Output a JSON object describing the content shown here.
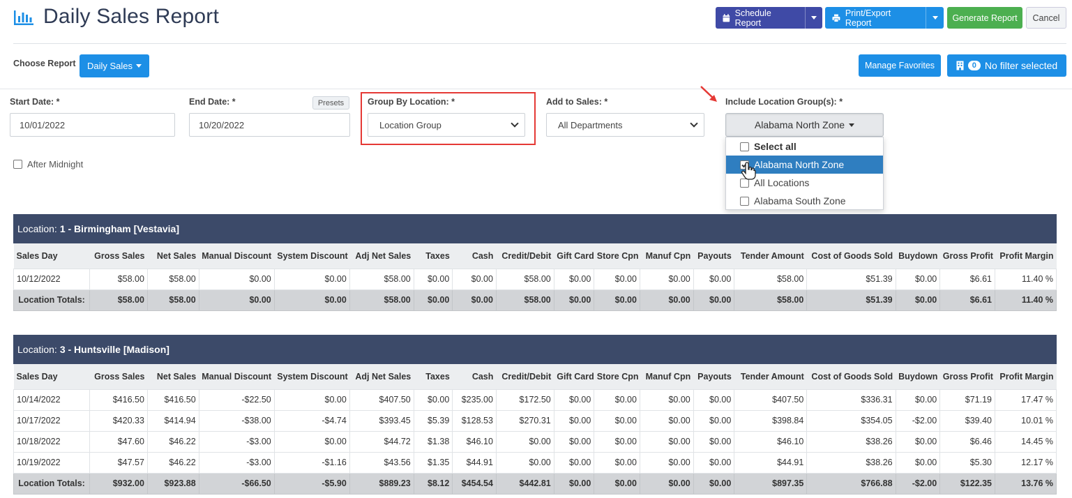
{
  "header": {
    "title": "Daily Sales Report",
    "schedule_label": "Schedule Report",
    "print_label": "Print/Export Report",
    "generate_label": "Generate Report",
    "cancel_label": "Cancel",
    "colors": {
      "schedule": "#3f4aa6",
      "primary": "#1d8fe6",
      "generate": "#4caf50",
      "title": "#2f3b55"
    }
  },
  "toolbar": {
    "choose_report_label": "Choose Report",
    "report_selected": "Daily Sales",
    "manage_favorites_label": "Manage Favorites",
    "filter_count": "0",
    "filter_label": "No filter selected"
  },
  "filters": {
    "start_date_label": "Start Date: *",
    "start_date_value": "10/01/2022",
    "end_date_label": "End Date: *",
    "end_date_value": "10/20/2022",
    "presets_label": "Presets",
    "group_by_label": "Group By Location: *",
    "group_by_value": "Location Group",
    "add_to_sales_label": "Add to Sales: *",
    "add_to_sales_value": "All Departments",
    "include_groups_label": "Include Location Group(s): *",
    "include_groups_value": "Alabama North Zone",
    "after_midnight_label": "After Midnight"
  },
  "location_dropdown": {
    "items": [
      {
        "label": "Select all",
        "checked": false
      },
      {
        "label": "Alabama North Zone",
        "checked": true
      },
      {
        "label": "All Locations",
        "checked": false
      },
      {
        "label": "Alabama South Zone",
        "checked": false
      }
    ]
  },
  "columns": [
    "Sales Day",
    "Gross Sales",
    "Net Sales",
    "Manual Discount",
    "System Discount",
    "Adj Net Sales",
    "Taxes",
    "Cash",
    "Credit/Debit",
    "Gift Card",
    "Store Cpn",
    "Manuf Cpn",
    "Payouts",
    "Tender Amount",
    "Cost of Goods Sold",
    "Buydown",
    "Gross Profit",
    "Profit Margin"
  ],
  "locations": [
    {
      "prefix": "Location:",
      "name": "1 - Birmingham [Vestavia]",
      "rows": [
        [
          "10/12/2022",
          "$58.00",
          "$58.00",
          "$0.00",
          "$0.00",
          "$58.00",
          "$0.00",
          "$0.00",
          "$58.00",
          "$0.00",
          "$0.00",
          "$0.00",
          "$0.00",
          "$58.00",
          "$51.39",
          "$0.00",
          "$6.61",
          "11.40 %"
        ]
      ],
      "totals": [
        "Location Totals:",
        "$58.00",
        "$58.00",
        "$0.00",
        "$0.00",
        "$58.00",
        "$0.00",
        "$0.00",
        "$58.00",
        "$0.00",
        "$0.00",
        "$0.00",
        "$0.00",
        "$58.00",
        "$51.39",
        "$0.00",
        "$6.61",
        "11.40 %"
      ]
    },
    {
      "prefix": "Location:",
      "name": "3 - Huntsville [Madison]",
      "rows": [
        [
          "10/14/2022",
          "$416.50",
          "$416.50",
          "-$22.50",
          "$0.00",
          "$407.50",
          "$0.00",
          "$235.00",
          "$172.50",
          "$0.00",
          "$0.00",
          "$0.00",
          "$0.00",
          "$407.50",
          "$336.31",
          "$0.00",
          "$71.19",
          "17.47 %"
        ],
        [
          "10/17/2022",
          "$420.33",
          "$414.94",
          "-$38.00",
          "-$4.74",
          "$393.45",
          "$5.39",
          "$128.53",
          "$270.31",
          "$0.00",
          "$0.00",
          "$0.00",
          "$0.00",
          "$398.84",
          "$354.05",
          "-$2.00",
          "$39.40",
          "10.01 %"
        ],
        [
          "10/18/2022",
          "$47.60",
          "$46.22",
          "-$3.00",
          "$0.00",
          "$44.72",
          "$1.38",
          "$46.10",
          "$0.00",
          "$0.00",
          "$0.00",
          "$0.00",
          "$0.00",
          "$46.10",
          "$38.26",
          "$0.00",
          "$6.46",
          "14.45 %"
        ],
        [
          "10/19/2022",
          "$47.57",
          "$46.22",
          "-$3.00",
          "-$1.16",
          "$43.56",
          "$1.35",
          "$44.91",
          "$0.00",
          "$0.00",
          "$0.00",
          "$0.00",
          "$0.00",
          "$44.91",
          "$38.26",
          "$0.00",
          "$5.30",
          "12.17 %"
        ]
      ],
      "totals": [
        "Location Totals:",
        "$932.00",
        "$923.88",
        "-$66.50",
        "-$5.90",
        "$889.23",
        "$8.12",
        "$454.54",
        "$442.81",
        "$0.00",
        "$0.00",
        "$0.00",
        "$0.00",
        "$897.35",
        "$766.88",
        "-$2.00",
        "$122.35",
        "13.76 %"
      ]
    }
  ]
}
